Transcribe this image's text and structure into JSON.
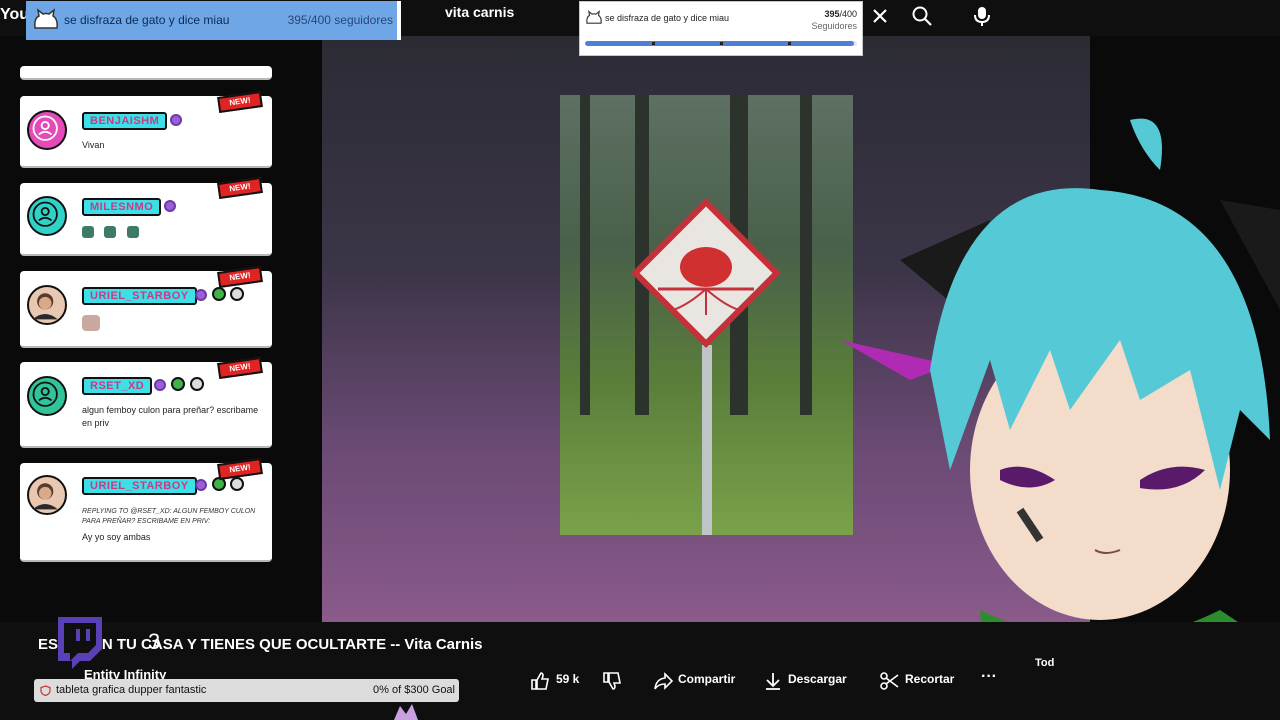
{
  "topbar": {
    "logo": "You",
    "search_value": "vita carnis",
    "icons": [
      "close-icon",
      "search-icon",
      "mic-icon"
    ]
  },
  "follower_goal": {
    "label": "se disfraza de gato y dice miau",
    "current": "395",
    "target": "/400",
    "suffix": " seguidores"
  },
  "follower_card": {
    "label": "se disfraza de gato y dice miau",
    "current": "395",
    "target": "/400",
    "unit": "Seguidores",
    "progress": 0.9875
  },
  "chat": {
    "messages": [
      {
        "user": "BENJAISHM",
        "text": "Vivan",
        "new_tag": "NEW!"
      },
      {
        "user": "MILESNMO",
        "text": "",
        "new_tag": "NEW!"
      },
      {
        "user": "URIEL_STARBOY",
        "text": "",
        "new_tag": "NEW!"
      },
      {
        "user": "RSET_XD",
        "text": "algun femboy culon para preñar? escribame en priv",
        "new_tag": "NEW!"
      },
      {
        "user": "URIEL_STARBOY",
        "reply": "REPLYING TO @RSET_XD: ALGUN FEMBOY CULON PARA PREÑAR? ESCRIBAME EN PRIV:",
        "text": "Ay yo soy ambas",
        "new_tag": "NEW!"
      }
    ]
  },
  "video": {
    "title": "ESTAN EN TU CASA Y TIENES QUE OCULTARTE -- Vita Carnis",
    "channel": "Entity Infinity",
    "overlay_number": "3",
    "likes": "59 k",
    "share": "Compartir",
    "download": "Descargar",
    "clip": "Recortar",
    "more": "···",
    "partial_label": "Tod"
  },
  "donation": {
    "label": "tableta grafica dupper fantastic",
    "amount": "0% of $300 Goal"
  },
  "colors": {
    "accent_cyan": "#3de0e6",
    "new_red": "#e02424",
    "goal_blue": "#6fa7e6"
  }
}
